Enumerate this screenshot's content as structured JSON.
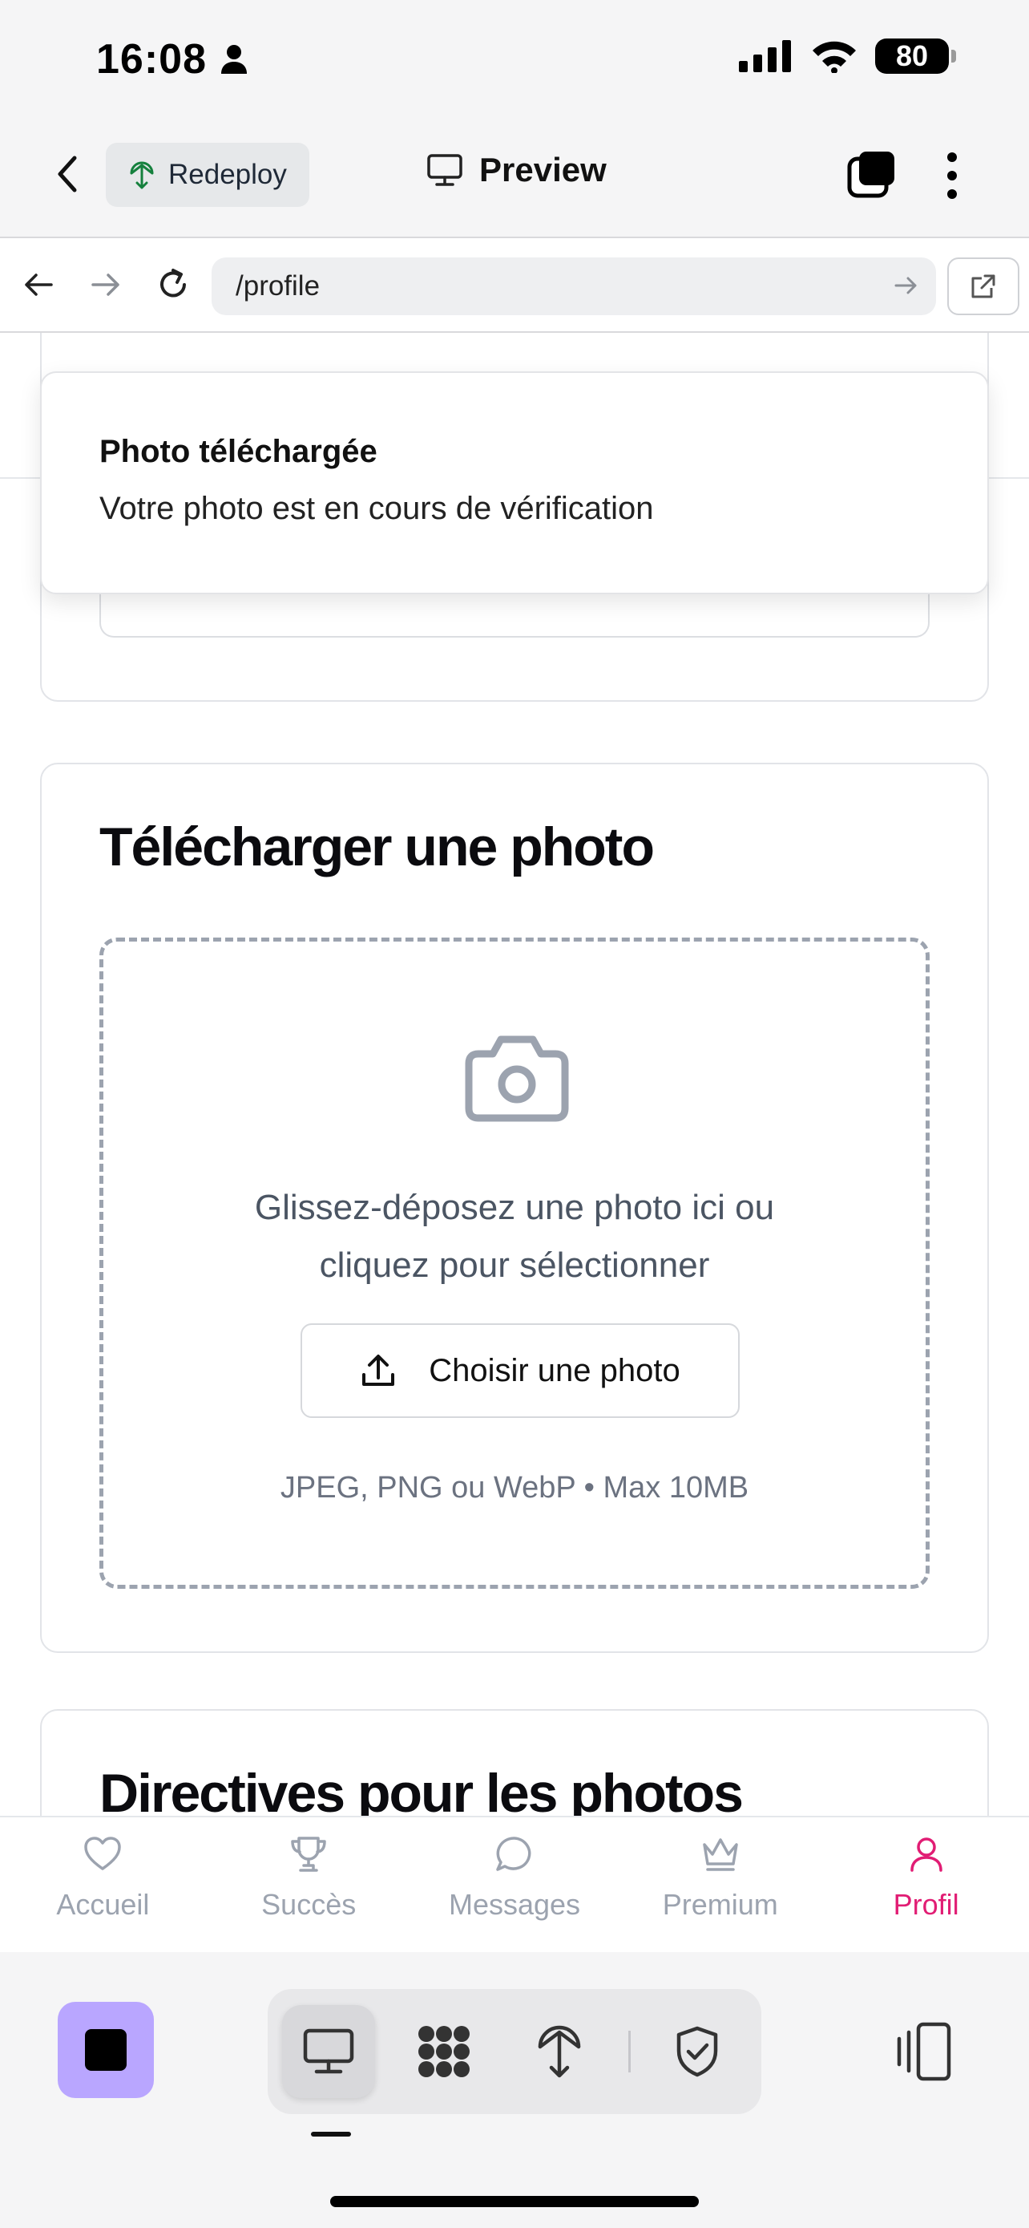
{
  "status_bar": {
    "time": "16:08",
    "battery": "80"
  },
  "app_header": {
    "redeploy_label": "Redeploy",
    "preview_label": "Preview"
  },
  "browser": {
    "url": "/profile"
  },
  "toast": {
    "title": "Photo téléchargée",
    "description": "Votre photo est en cours de vérification"
  },
  "upload_card": {
    "title": "Télécharger une photo",
    "drop_text_line1": "Glissez-déposez une photo ici ou",
    "drop_text_line2": "cliquez pour sélectionner",
    "button_label": "Choisir une photo",
    "formats": "JPEG, PNG ou WebP • Max 10MB"
  },
  "guidelines_card": {
    "title": "Directives pour les photos"
  },
  "tabbar": {
    "items": [
      {
        "label": "Accueil",
        "icon": "heart-icon"
      },
      {
        "label": "Succès",
        "icon": "trophy-icon"
      },
      {
        "label": "Messages",
        "icon": "chat-bubble-icon"
      },
      {
        "label": "Premium",
        "icon": "crown-icon"
      },
      {
        "label": "Profil",
        "icon": "user-icon"
      }
    ],
    "active": "Profil",
    "active_color": "#e11d74",
    "inactive_color": "#9ca3af"
  },
  "dev_toolbar": {
    "stop_color": "#b9a6ff",
    "segments": [
      "monitor-icon",
      "apps-grid-icon",
      "deploy-icon",
      "shield-check-icon"
    ],
    "selected_segment": "monitor-icon"
  }
}
